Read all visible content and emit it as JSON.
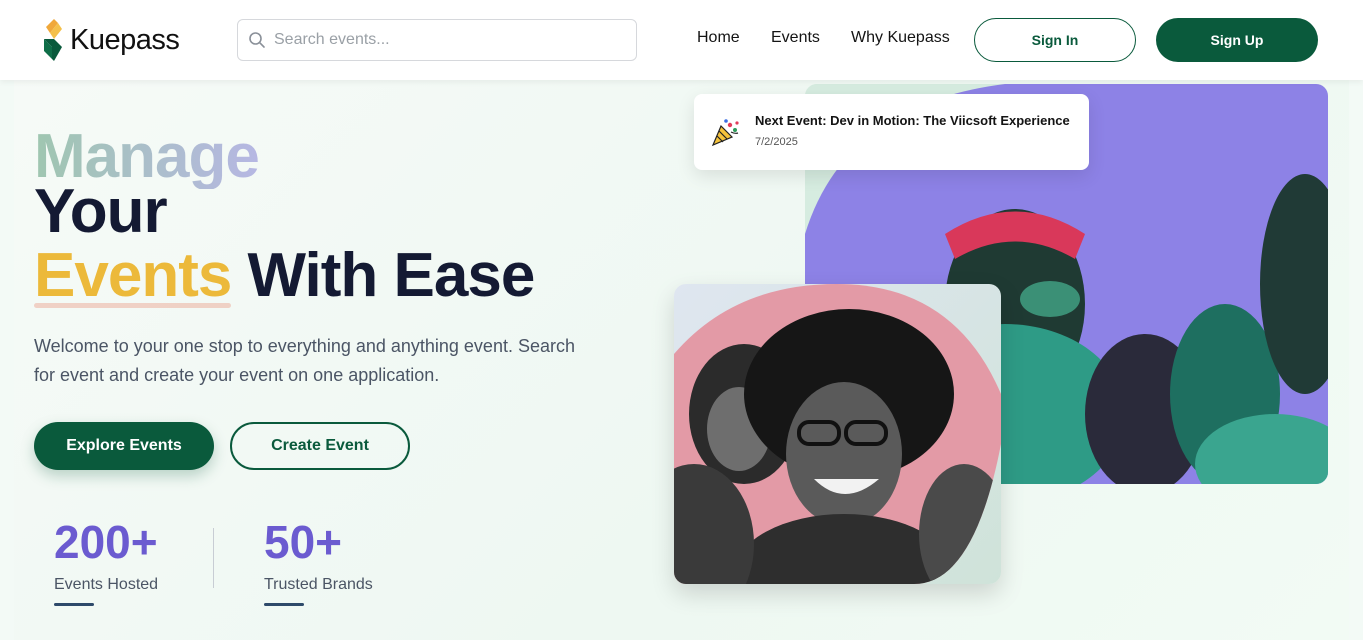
{
  "header": {
    "logo_text": "Kuepass",
    "search_placeholder": "Search events...",
    "nav": {
      "home": "Home",
      "events": "Events",
      "why": "Why Kuepass"
    },
    "sign_in": "Sign In",
    "sign_up": "Sign Up"
  },
  "hero": {
    "title_word1": "Manage",
    "title_word2": "Your",
    "title_highlight": "Events",
    "title_rest": " With Ease",
    "description": "Welcome to your one stop to everything and anything event. Search for event and create your event on one application.",
    "explore_button": "Explore Events",
    "create_button": "Create Event",
    "stats": [
      {
        "value": "200+",
        "label": "Events Hosted"
      },
      {
        "value": "50+",
        "label": "Trusted Brands"
      }
    ]
  },
  "next_event": {
    "title": "Next Event: Dev in Motion: The Viicsoft Experience",
    "date": "7/2/2025",
    "icon": "party-popper-icon"
  },
  "colors": {
    "brand_green": "#0a5a3c",
    "accent_yellow": "#ecb93a",
    "stat_purple": "#6b5bd0",
    "photo_purple": "#8d82e6",
    "photo_pink": "#e39aa6"
  }
}
